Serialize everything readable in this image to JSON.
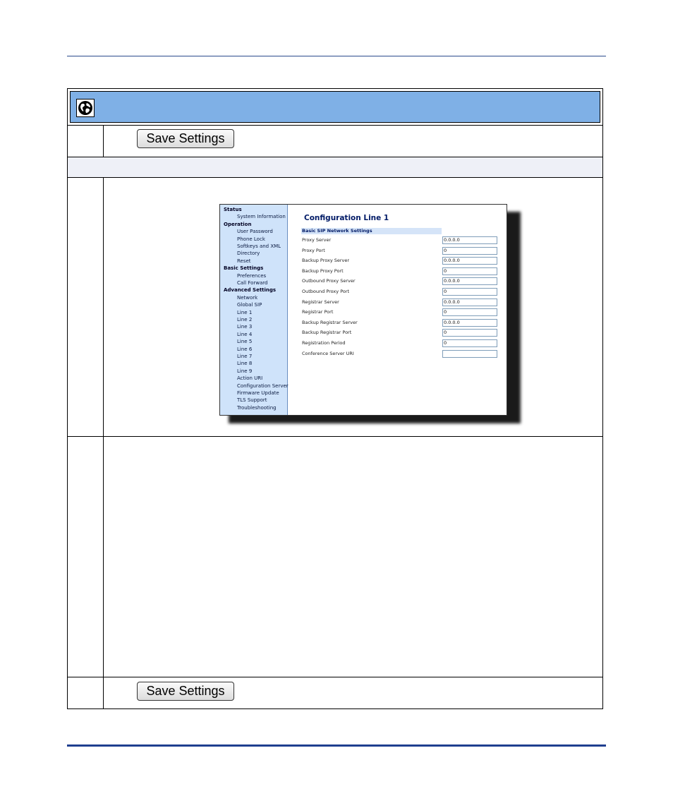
{
  "buttons": {
    "save_top": "Save Settings",
    "save_bottom": "Save Settings"
  },
  "icons": {
    "header": "globe-icon"
  },
  "colors": {
    "header_bar": "#7fb0e6",
    "nav_panel": "#cfe3fa",
    "rule": "#1f3f8f"
  },
  "screenshot": {
    "title": "Configuration Line 1",
    "section": "Basic SIP Network Settings",
    "nav": [
      {
        "label": "Status",
        "type": "head"
      },
      {
        "label": "System Information",
        "type": "sub"
      },
      {
        "label": "Operation",
        "type": "head"
      },
      {
        "label": "User Password",
        "type": "sub"
      },
      {
        "label": "Phone Lock",
        "type": "sub"
      },
      {
        "label": "Softkeys and XML",
        "type": "sub"
      },
      {
        "label": "Directory",
        "type": "sub"
      },
      {
        "label": "Reset",
        "type": "sub"
      },
      {
        "label": "Basic Settings",
        "type": "head"
      },
      {
        "label": "Preferences",
        "type": "sub"
      },
      {
        "label": "Call Forward",
        "type": "sub"
      },
      {
        "label": "Advanced Settings",
        "type": "head"
      },
      {
        "label": "Network",
        "type": "sub"
      },
      {
        "label": "Global SIP",
        "type": "sub"
      },
      {
        "label": "Line 1",
        "type": "sub"
      },
      {
        "label": "Line 2",
        "type": "sub"
      },
      {
        "label": "Line 3",
        "type": "sub"
      },
      {
        "label": "Line 4",
        "type": "sub"
      },
      {
        "label": "Line 5",
        "type": "sub"
      },
      {
        "label": "Line 6",
        "type": "sub"
      },
      {
        "label": "Line 7",
        "type": "sub"
      },
      {
        "label": "Line 8",
        "type": "sub"
      },
      {
        "label": "Line 9",
        "type": "sub"
      },
      {
        "label": "Action URI",
        "type": "sub"
      },
      {
        "label": "Configuration Server",
        "type": "sub"
      },
      {
        "label": "Firmware Update",
        "type": "sub"
      },
      {
        "label": "TLS Support",
        "type": "sub"
      },
      {
        "label": "Troubleshooting",
        "type": "sub"
      }
    ],
    "fields": [
      {
        "label": "Proxy Server",
        "value": "0.0.0.0"
      },
      {
        "label": "Proxy Port",
        "value": "0"
      },
      {
        "label": "Backup Proxy Server",
        "value": "0.0.0.0"
      },
      {
        "label": "Backup Proxy Port",
        "value": "0"
      },
      {
        "label": "Outbound Proxy Server",
        "value": "0.0.0.0"
      },
      {
        "label": "Outbound Proxy Port",
        "value": "0"
      },
      {
        "label": "Registrar Server",
        "value": "0.0.0.0"
      },
      {
        "label": "Registrar Port",
        "value": "0"
      },
      {
        "label": "Backup Registrar Server",
        "value": "0.0.0.0"
      },
      {
        "label": "Backup Registrar Port",
        "value": "0"
      },
      {
        "label": "Registration Period",
        "value": "0"
      },
      {
        "label": "Conference Server URI",
        "value": ""
      }
    ]
  }
}
